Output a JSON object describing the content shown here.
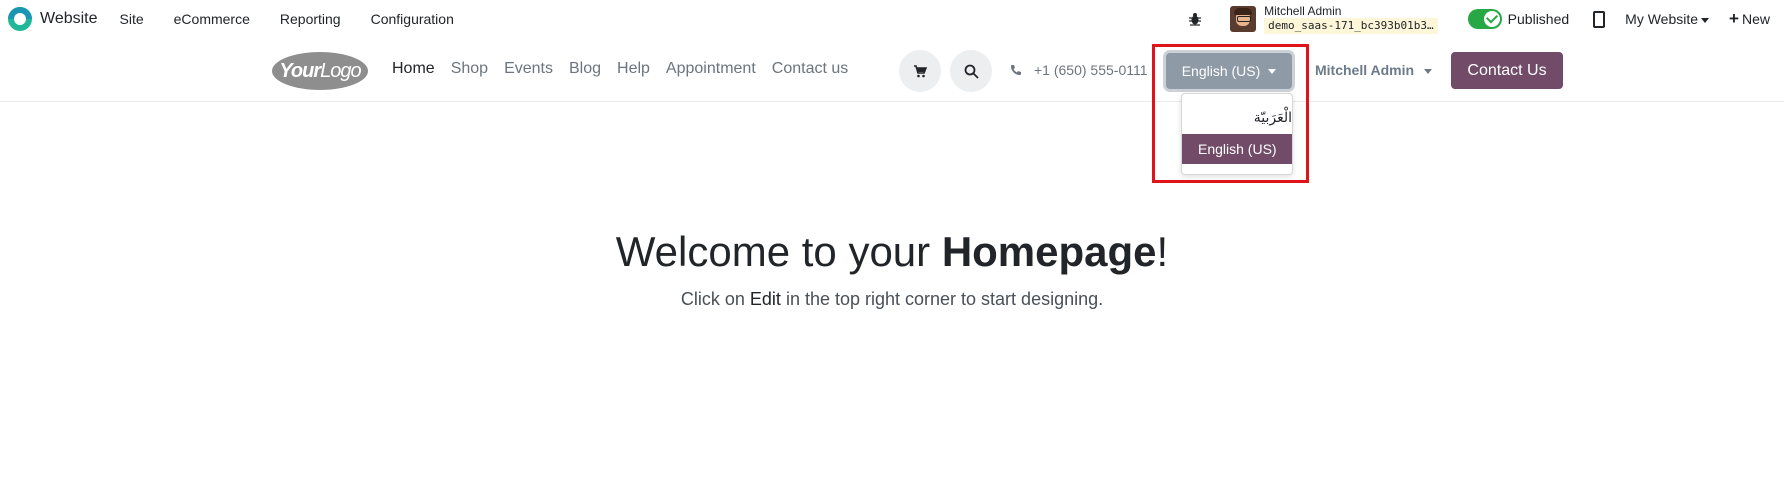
{
  "topbar": {
    "app_name": "Website",
    "menu": [
      "Site",
      "eCommerce",
      "Reporting",
      "Configuration"
    ],
    "user_name": "Mitchell Admin",
    "database": "demo_saas-171_bc393b01b3…",
    "published_label": "Published",
    "published": true,
    "my_website_label": "My Website",
    "new_label": "New",
    "icons": [
      "website-app-icon",
      "bug-icon",
      "avatar",
      "toggle-switch",
      "mobile-preview-icon",
      "plus-icon"
    ]
  },
  "header": {
    "logo_text_bold": "Your",
    "logo_text": "Logo",
    "nav": [
      "Home",
      "Shop",
      "Events",
      "Blog",
      "Help",
      "Appointment",
      "Contact us"
    ],
    "active_nav": "Home",
    "phone": "+1 (650) 555-0111",
    "language_button": "English (US)",
    "user_menu": "Mitchell Admin",
    "contact_button": "Contact Us",
    "icons": [
      "cart-icon",
      "search-icon",
      "phone-icon"
    ]
  },
  "language_dropdown": {
    "items": [
      "الْعَرَبيّة",
      "English (US)"
    ],
    "selected": "English (US)"
  },
  "hero": {
    "title_prefix": "Welcome to your ",
    "title_bold": "Homepage",
    "title_suffix": "!",
    "sub_prefix": "Click on ",
    "sub_edit": "Edit",
    "sub_suffix": " in the top right corner to start designing."
  },
  "colors": {
    "brand_purple": "#714b67",
    "language_button_gray": "#8e9aa6",
    "highlight_red": "#e0131b",
    "published_green": "#28a745"
  }
}
